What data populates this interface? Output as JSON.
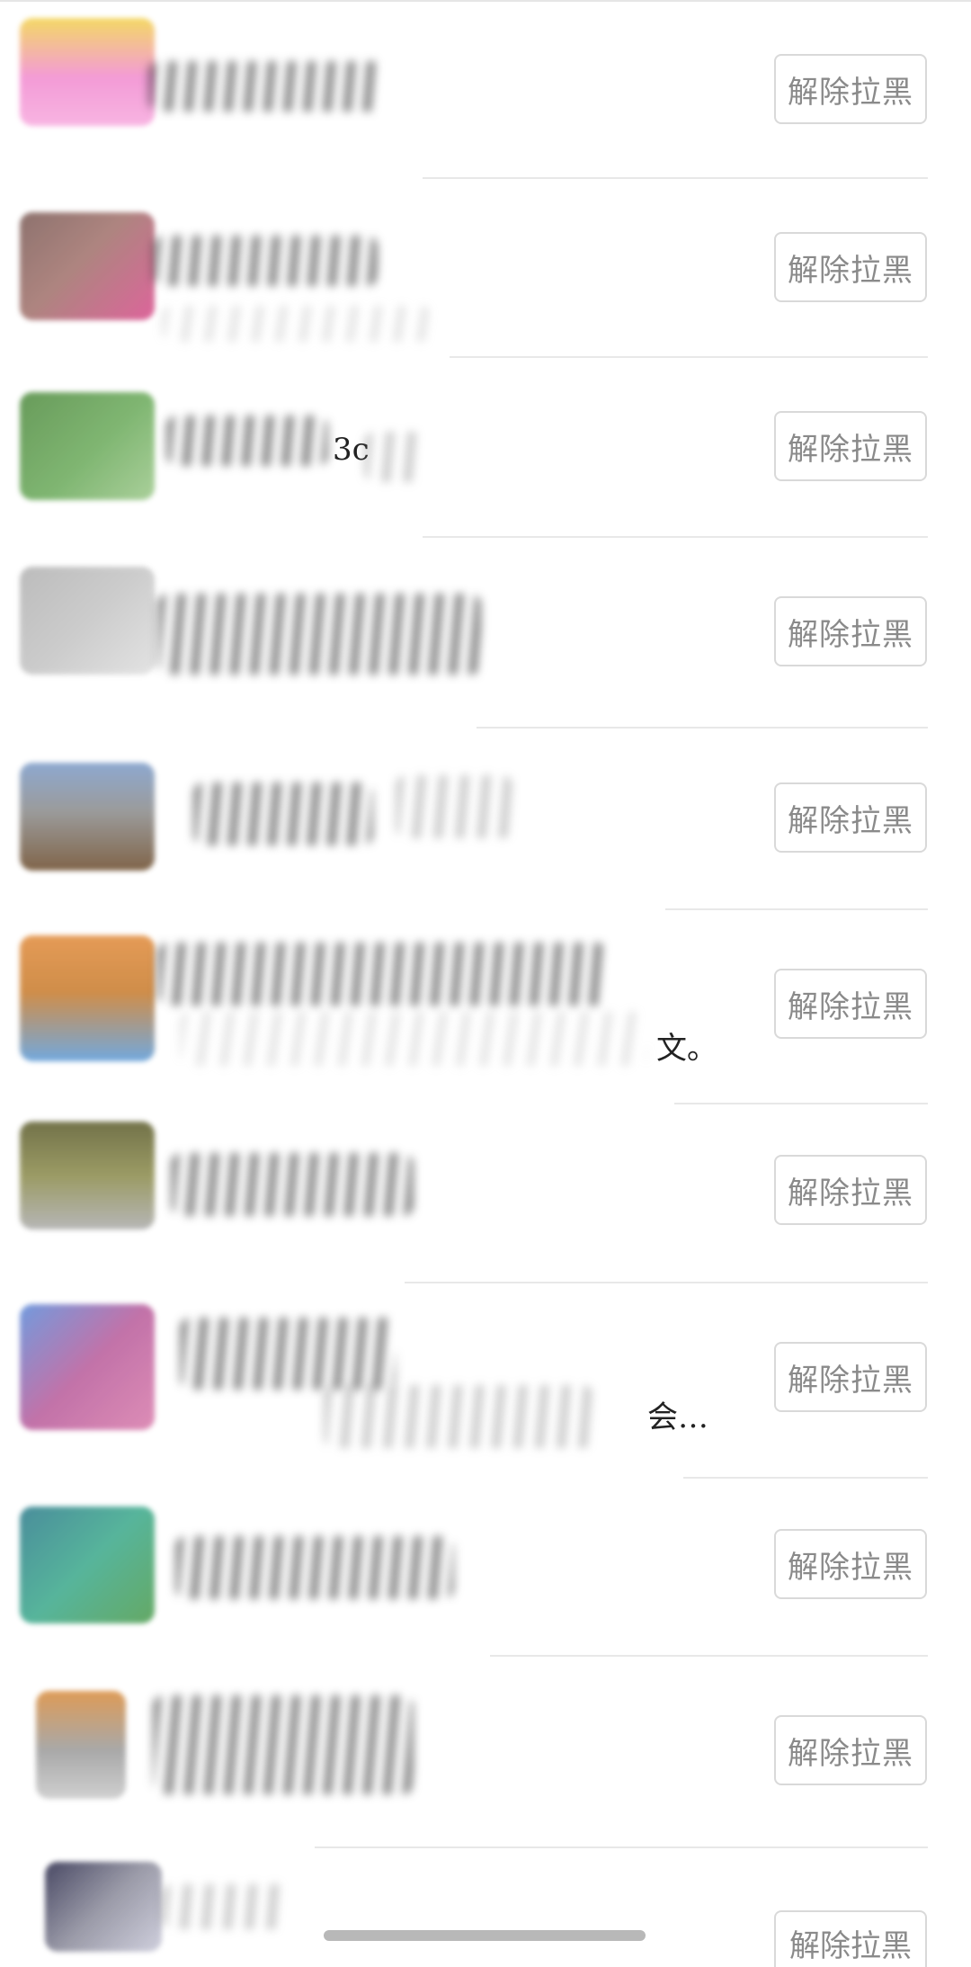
{
  "list": {
    "unblock_label": "解除拉黑",
    "rows": [
      {
        "avatar_colors": [
          "#f28ad0",
          "#f2d24a",
          "#f7a8dd"
        ],
        "visible_fragment": ""
      },
      {
        "avatar_colors": [
          "#a0706a",
          "#d84a8a",
          "#7a5a55"
        ],
        "visible_fragment": ""
      },
      {
        "avatar_colors": [
          "#6aaa5a",
          "#4e8a3e",
          "#9cc88a"
        ],
        "visible_fragment": "3c"
      },
      {
        "avatar_colors": [
          "#9a9a9a",
          "#c8c8c8",
          "#7a7a7a"
        ],
        "visible_fragment": ""
      },
      {
        "avatar_colors": [
          "#7a9ac8",
          "#6a4a2a",
          "#8a8a8a"
        ],
        "visible_fragment": ""
      },
      {
        "avatar_colors": [
          "#e08a3a",
          "#5a9ad8",
          "#c87a2a"
        ],
        "visible_fragment": "文。"
      },
      {
        "avatar_colors": [
          "#5a5a2a",
          "#8a8a4a",
          "#aaaaaa"
        ],
        "visible_fragment": ""
      },
      {
        "avatar_colors": [
          "#5a8ad8",
          "#b85a9a",
          "#d87aaa"
        ],
        "visible_fragment": "会…"
      },
      {
        "avatar_colors": [
          "#3aa88a",
          "#4a9a4a",
          "#2a7a8a"
        ],
        "visible_fragment": ""
      },
      {
        "avatar_colors": [
          "#d88a3a",
          "#9a9a9a",
          "#c8c8c8"
        ],
        "visible_fragment": ""
      },
      {
        "avatar_colors": [
          "#2a2a4a",
          "#8a8a9a",
          "#c8c8d8"
        ],
        "visible_fragment": ""
      }
    ]
  },
  "colors": {
    "background": "#ffffff",
    "button_border": "#d9d9d9",
    "button_text": "#8a8a8a",
    "divider": "#e8e8e8",
    "home_indicator": "#b8b8b8"
  }
}
